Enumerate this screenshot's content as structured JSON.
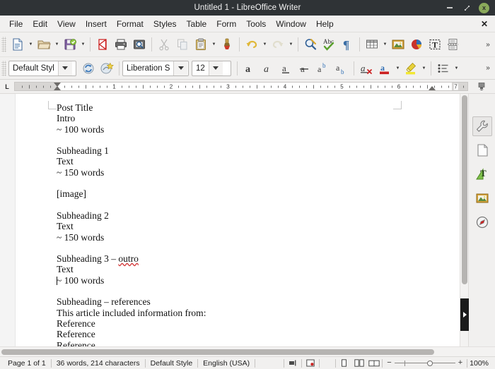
{
  "window": {
    "title": "Untitled 1 - LibreOffice Writer",
    "minimize_label": "Minimize",
    "maximize_label": "Restore",
    "close_label": "x"
  },
  "menubar": {
    "items": [
      {
        "label": "File"
      },
      {
        "label": "Edit"
      },
      {
        "label": "View"
      },
      {
        "label": "Insert"
      },
      {
        "label": "Format"
      },
      {
        "label": "Styles"
      },
      {
        "label": "Table"
      },
      {
        "label": "Form"
      },
      {
        "label": "Tools"
      },
      {
        "label": "Window"
      },
      {
        "label": "Help"
      }
    ],
    "close_document": "✕"
  },
  "standard_toolbar": {
    "overflow_label": "»",
    "buttons": [
      {
        "name": "new-document-icon",
        "tooltip": "New"
      },
      {
        "name": "open-document-icon",
        "tooltip": "Open"
      },
      {
        "name": "save-document-icon",
        "tooltip": "Save"
      },
      {
        "name": "export-pdf-icon",
        "tooltip": "Export as PDF"
      },
      {
        "name": "print-icon",
        "tooltip": "Print"
      },
      {
        "name": "print-preview-icon",
        "tooltip": "Toggle Print Preview"
      },
      {
        "name": "cut-icon",
        "tooltip": "Cut"
      },
      {
        "name": "copy-icon",
        "tooltip": "Copy"
      },
      {
        "name": "paste-icon",
        "tooltip": "Paste"
      },
      {
        "name": "clone-formatting-icon",
        "tooltip": "Clone Formatting"
      },
      {
        "name": "undo-icon",
        "tooltip": "Undo"
      },
      {
        "name": "redo-icon",
        "tooltip": "Redo"
      },
      {
        "name": "find-replace-icon",
        "tooltip": "Find and Replace"
      },
      {
        "name": "spelling-icon",
        "tooltip": "Check Spelling"
      },
      {
        "name": "formatting-marks-icon",
        "tooltip": "Formatting Marks"
      },
      {
        "name": "insert-table-icon",
        "tooltip": "Insert Table"
      },
      {
        "name": "insert-image-icon",
        "tooltip": "Insert Image"
      },
      {
        "name": "insert-chart-icon",
        "tooltip": "Insert Chart"
      },
      {
        "name": "insert-text-box-icon",
        "tooltip": "Insert Text Box"
      },
      {
        "name": "insert-page-break-icon",
        "tooltip": "Insert Page Break"
      }
    ]
  },
  "formatting_toolbar": {
    "paragraph_style": "Default Styl",
    "font_name": "Liberation S",
    "font_size": "12",
    "overflow_label": "»",
    "buttons": [
      {
        "name": "update-style-icon",
        "tooltip": "Update Selected Style"
      },
      {
        "name": "new-style-icon",
        "tooltip": "New Style from Selection"
      },
      {
        "name": "bold-icon",
        "label": "a",
        "tooltip": "Bold"
      },
      {
        "name": "italic-icon",
        "label": "a",
        "tooltip": "Italic"
      },
      {
        "name": "underline-icon",
        "label": "a",
        "tooltip": "Underline"
      },
      {
        "name": "strikethrough-icon",
        "label": "a",
        "tooltip": "Strikethrough"
      },
      {
        "name": "superscript-icon",
        "label": "ab",
        "tooltip": "Superscript"
      },
      {
        "name": "subscript-icon",
        "label": "ab",
        "tooltip": "Subscript"
      },
      {
        "name": "clear-formatting-icon",
        "label": "a",
        "tooltip": "Clear Direct Formatting"
      },
      {
        "name": "font-color-icon",
        "label": "a",
        "tooltip": "Font Color"
      },
      {
        "name": "highlight-color-icon",
        "label": "a",
        "tooltip": "Character Highlighting Color"
      },
      {
        "name": "unordered-list-icon",
        "tooltip": "Unordered List"
      }
    ]
  },
  "ruler": {
    "corner_label": "L",
    "unit_numbers": [
      "1",
      "2",
      "3",
      "4",
      "5",
      "6",
      "7"
    ],
    "left_indent_pos": "0",
    "right_indent_pos": "6.5"
  },
  "document": {
    "lines": [
      {
        "text": "Post Title"
      },
      {
        "text": "Intro"
      },
      {
        "text": "~ 100 words"
      },
      {
        "text": ""
      },
      {
        "text": "Subheading 1"
      },
      {
        "text": "Text"
      },
      {
        "text": "~ 150 words"
      },
      {
        "text": ""
      },
      {
        "text": "[image]"
      },
      {
        "text": ""
      },
      {
        "text": "Subheading 2"
      },
      {
        "text": "Text"
      },
      {
        "text": "~ 150 words"
      },
      {
        "text": ""
      },
      {
        "text": "Subheading 3 – outro",
        "misspelled": "outro"
      },
      {
        "text": "Text"
      },
      {
        "text": "~ 100 words",
        "caret": true
      },
      {
        "text": ""
      },
      {
        "text": "Subheading – references"
      },
      {
        "text": "This article included information from:"
      },
      {
        "text": "Reference"
      },
      {
        "text": "Reference"
      },
      {
        "text": "Reference"
      }
    ]
  },
  "sidebar": {
    "settings_label": "Sidebar Settings",
    "items": [
      {
        "name": "properties-deck",
        "label": "Properties",
        "active": true
      },
      {
        "name": "page-deck",
        "label": "Page"
      },
      {
        "name": "styles-deck",
        "label": "Styles"
      },
      {
        "name": "gallery-deck",
        "label": "Gallery"
      },
      {
        "name": "navigator-deck",
        "label": "Navigator"
      }
    ]
  },
  "statusbar": {
    "page": "Page 1 of 1",
    "word_count": "36 words, 214 characters",
    "page_style": "Default Style",
    "language": "English (USA)",
    "selection_mode_label": "Selection Mode",
    "save_status_label": "Document has been modified",
    "view_single_label": "Single-page View",
    "view_multi_label": "Multiple-page View",
    "view_book_label": "Book View",
    "zoom_minus": "−",
    "zoom_plus": "+",
    "zoom_value": "100%"
  }
}
